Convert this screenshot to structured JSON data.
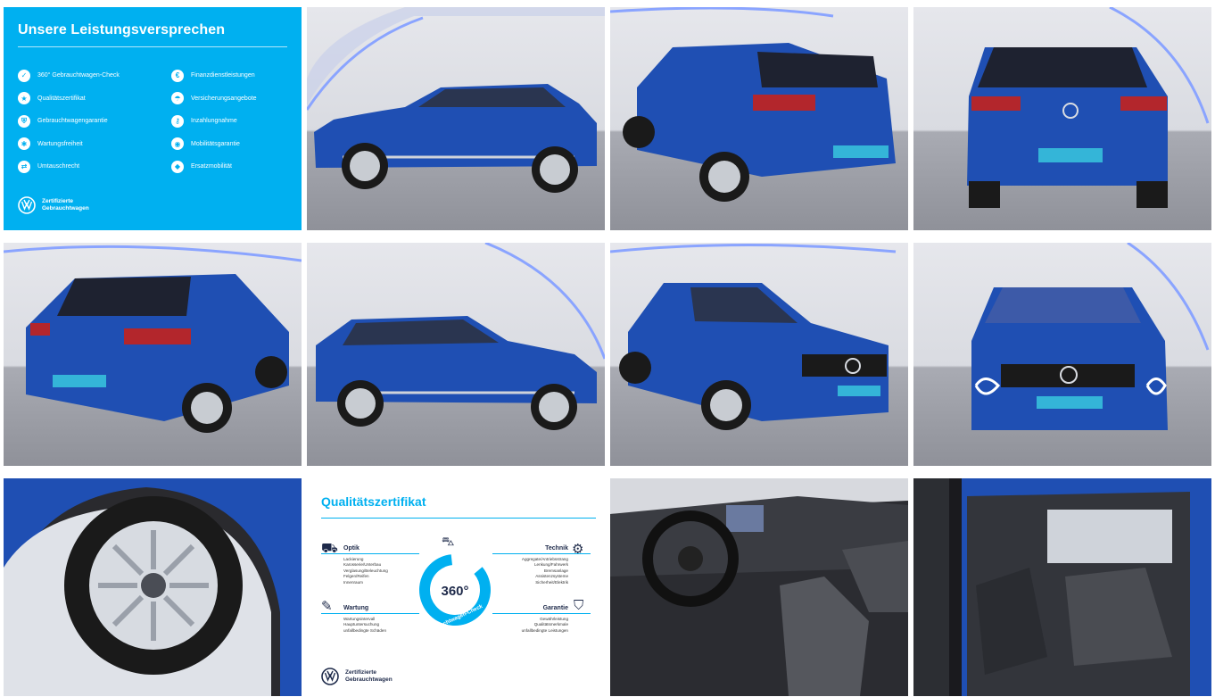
{
  "gallery": {
    "promise": {
      "title": "Unsere Leistungsversprechen",
      "left_items": [
        "360° Gebrauchtwagen-Check",
        "Qualitätszertifikat",
        "Gebrauchtwagengarantie",
        "Wartungsfreiheit",
        "Umtauschrecht"
      ],
      "right_items": [
        "Finanzdienstleistungen",
        "Versicherungsangebote",
        "Inzahlungnahme",
        "Mobilitätsgarantie",
        "Ersatzmobilität"
      ],
      "logo_line1": "Zertifizierte",
      "logo_line2": "Gebrauchtwagen",
      "accent": "#00b0f0"
    },
    "quality": {
      "title": "Qualitätszertifikat",
      "center_number": "360°",
      "center_label": "Gebrauchtwagen-Check",
      "optik": {
        "title": "Optik",
        "items": [
          "Lackierung",
          "Karosserie/Unterbau",
          "Verglasung/Beleuchtung",
          "Felgen/Reifen",
          "Innenraum"
        ]
      },
      "wartung": {
        "title": "Wartung",
        "items": [
          "Wartungsintervall",
          "Hauptuntersuchung",
          "unfallbedingte Schäden"
        ]
      },
      "technik": {
        "title": "Technik",
        "items": [
          "Aggregate/Antriebsstrang",
          "Lenkung/Fahrwerk",
          "Bremsanlage",
          "Assistenzsysteme",
          "Sicherheit/Elektrik"
        ]
      },
      "garantie": {
        "title": "Garantie",
        "items": [
          "Gewährleistung",
          "Qualitätsmerkmale",
          "unfallbedingte Leistungen"
        ]
      },
      "logo_line1": "Zertifizierte",
      "logo_line2": "Gebrauchtwagen"
    },
    "badge_text": "Zertifizierte Gebrauchtwagen",
    "car_color": "#1f4fb3"
  }
}
